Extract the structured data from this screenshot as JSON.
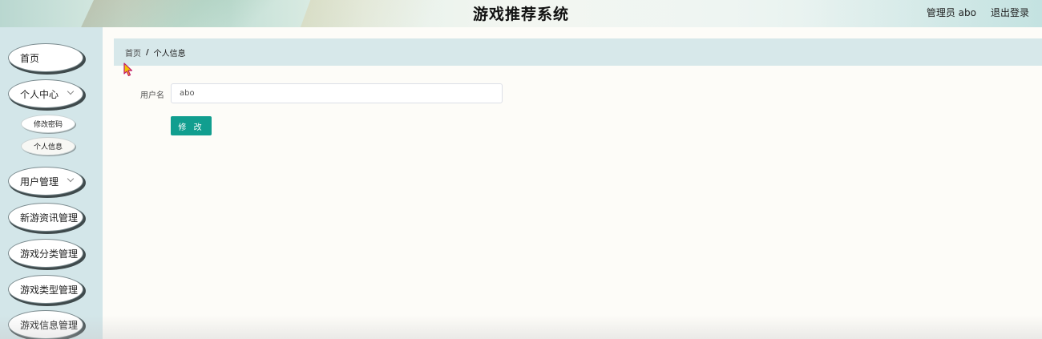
{
  "header": {
    "title": "游戏推荐系统",
    "admin_label": "管理员 abo",
    "logout_label": "退出登录"
  },
  "sidebar": {
    "items": [
      {
        "label": "首页",
        "has_dropdown": false
      },
      {
        "label": "个人中心",
        "has_dropdown": true
      },
      {
        "label": "用户管理",
        "has_dropdown": true
      },
      {
        "label": "新游资讯管理",
        "has_dropdown": false
      },
      {
        "label": "游戏分类管理",
        "has_dropdown": false
      },
      {
        "label": "游戏类型管理",
        "has_dropdown": false
      },
      {
        "label": "游戏信息管理",
        "has_dropdown": false
      }
    ],
    "subitems": [
      {
        "label": "修改密码"
      },
      {
        "label": "个人信息",
        "active": true
      }
    ]
  },
  "breadcrumb": {
    "home": "首页",
    "separator": "/",
    "current": "个人信息"
  },
  "form": {
    "username_label": "用户名",
    "username_value": "abo",
    "submit_label": "修 改"
  },
  "colors": {
    "sidebar_bg": "#d3e6e9",
    "breadcrumb_bg": "#d7e8ea",
    "primary_button": "#119e8f"
  }
}
